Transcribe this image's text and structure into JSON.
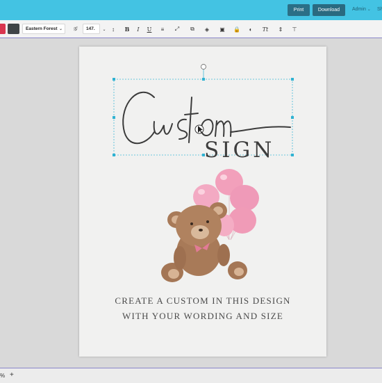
{
  "header": {
    "print_label": "Print",
    "download_label": "Download",
    "admin_label": "Admin",
    "share_label": "Sh"
  },
  "toolbar": {
    "font_name": "Eastern Forest",
    "font_size": "147.",
    "colors": {
      "accent_red": "#d9354f",
      "text_color": "#3f4447"
    },
    "icons": [
      "font-style-icon",
      "letter-spacing-icon",
      "bold-icon",
      "italic-icon",
      "underline-icon",
      "align-icon",
      "resize-icon",
      "duplicate-icon",
      "layers-icon",
      "copy-icon",
      "lock-icon",
      "effects-icon",
      "text-transform-icon",
      "line-height-icon",
      "more-icon"
    ]
  },
  "canvas": {
    "script_text": "Custom",
    "sign_text": "SIGN",
    "line1": "CREATE A CUSTOM IN THIS DESIGN",
    "line2": "WITH YOUR WORDING AND SIZE"
  },
  "footer": {
    "zoom_label": "%",
    "add_label": "+"
  },
  "theme": {
    "topbar": "#43c3e3",
    "button": "#2b6f86",
    "selection": "#3fb9d6",
    "balloon": "#f2a0bb",
    "bear": "#a87a58"
  }
}
